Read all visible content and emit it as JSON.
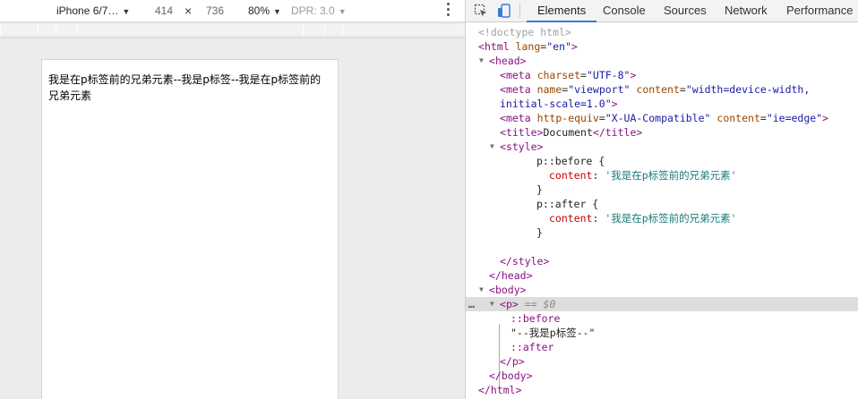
{
  "device_toolbar": {
    "device_name": "iPhone 6/7…",
    "width": "414",
    "times": "×",
    "height": "736",
    "zoom": "80%",
    "dpr": "DPR: 3.0"
  },
  "viewport": {
    "content_text": "我是在p标签前的兄弟元素--我是p标签--我是在p标签前的兄弟元素"
  },
  "devtools": {
    "tabs": [
      "Elements",
      "Console",
      "Sources",
      "Network",
      "Performance"
    ],
    "active_tab": "Elements",
    "icons": [
      "inspect-icon",
      "device-toggle-icon"
    ],
    "dom_lines": {
      "doctype": "<!doctype html>",
      "html_open_tag": "html",
      "html_lang_attr": "lang",
      "html_lang_val": "\"en\"",
      "head": "head",
      "meta": "meta",
      "charset_attr": "charset",
      "charset_val": "\"UTF-8\"",
      "name_attr": "name",
      "name_val": "\"viewport\"",
      "content_attr": "content",
      "content_val_1": "\"width=device-width,",
      "content_val_2": "initial-scale=1.0\"",
      "http_equiv_attr": "http-equiv",
      "http_equiv_val": "\"X-UA-Compatible\"",
      "ie_content_val": "\"ie=edge\"",
      "title_tag": "title",
      "title_text": "Document",
      "style_tag": "style",
      "before_selector": "p::before {",
      "css_content_prop": "content",
      "before_content_val": "'我是在p标签前的兄弟元素'",
      "close_brace": "}",
      "after_selector": "p::after {",
      "after_content_val": "'我是在p标签前的兄弟元素'",
      "body_tag": "body",
      "p_tag": "p",
      "selected_marker": "== $0",
      "pseudo_before": "::before",
      "p_text": "\"--我是p标签--\"",
      "pseudo_after": "::after",
      "html_close": "html"
    }
  }
}
